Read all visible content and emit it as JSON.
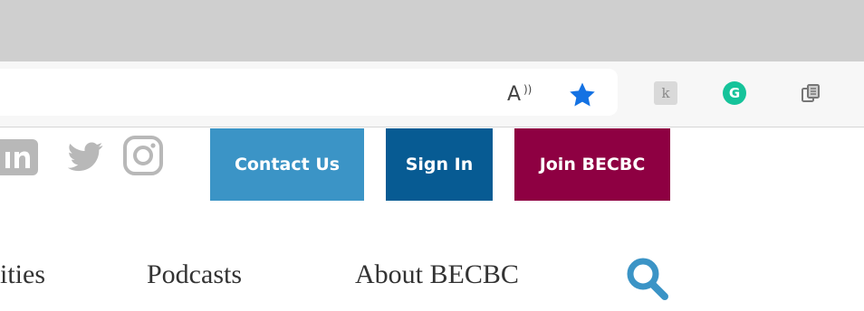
{
  "browser": {
    "icons": {
      "read_aloud": "read-aloud-icon",
      "read_aloud_glyph": "A",
      "favorite": "star-filled-icon",
      "extension_1": "kami-extension-icon",
      "extension_1_glyph": "k",
      "extension_2": "grammarly-extension-icon",
      "extension_2_glyph": "G",
      "collections": "collections-icon"
    },
    "colors": {
      "star": "#1472e3",
      "grammarly": "#15c39a"
    }
  },
  "header": {
    "social": [
      "linkedin-icon",
      "twitter-icon",
      "instagram-icon"
    ],
    "buttons": {
      "contact": "Contact Us",
      "signin": "Sign In",
      "join": "Join BECBC"
    },
    "button_colors": {
      "contact": "#3b94c6",
      "signin": "#075b93",
      "join": "#8e0042"
    }
  },
  "nav": {
    "items": [
      "ities",
      "Podcasts",
      "About BECBC"
    ],
    "search_icon": "search-icon",
    "search_color": "#3b94c6"
  }
}
